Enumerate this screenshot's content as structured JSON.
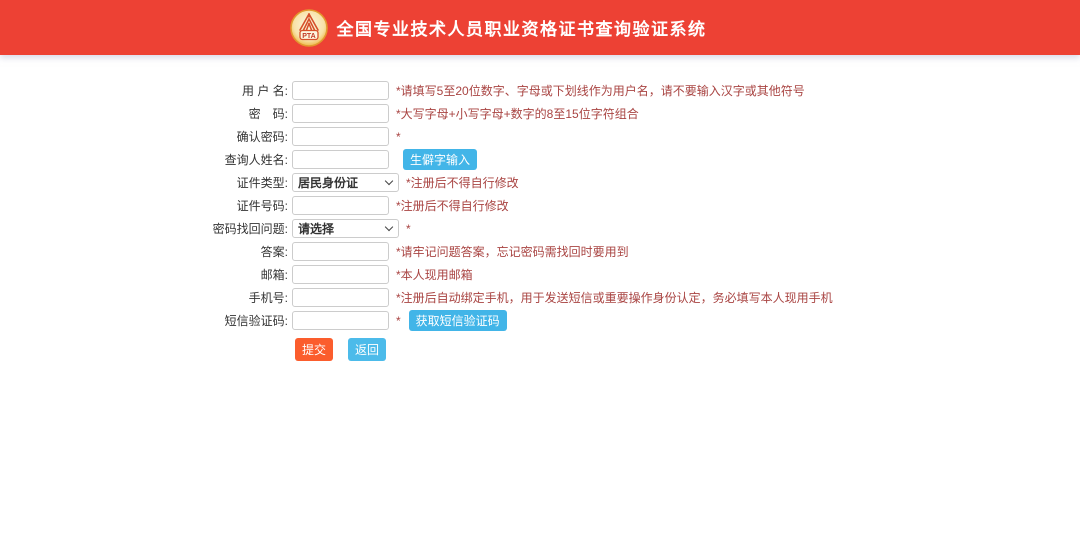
{
  "colors": {
    "header_bg": "#ed4134",
    "primary_blue": "#42b5e8",
    "submit_orange": "#fb5d2d",
    "hint_red": "#a94442"
  },
  "header": {
    "title": "全国专业技术人员职业资格证书查询验证系统",
    "logo_text": "PTA"
  },
  "form": {
    "rows": [
      {
        "label": "用 户 名:",
        "value": "",
        "placeholder": "",
        "hint": "*请填写5至20位数字、字母或下划线作为用户名，请不要输入汉字或其他符号"
      },
      {
        "label": "密　码:",
        "value": "",
        "placeholder": "",
        "hint": "*大写字母+小写字母+数字的8至15位字符组合"
      },
      {
        "label": "确认密码:",
        "value": "",
        "placeholder": "",
        "hint": "*"
      },
      {
        "label": "查询人姓名:",
        "value": "",
        "placeholder": "",
        "button": "生僻字输入"
      },
      {
        "label": "证件类型:",
        "selected": "居民身份证",
        "hint": "*注册后不得自行修改"
      },
      {
        "label": "证件号码:",
        "value": "",
        "placeholder": "",
        "hint": "*注册后不得自行修改"
      },
      {
        "label": "密码找回问题:",
        "selected": "请选择",
        "hint": "*"
      },
      {
        "label": "答案:",
        "value": "",
        "placeholder": "",
        "hint": "*请牢记问题答案，忘记密码需找回时要用到"
      },
      {
        "label": "邮箱:",
        "value": "",
        "placeholder": "",
        "hint": "*本人现用邮箱"
      },
      {
        "label": "手机号:",
        "value": "",
        "placeholder": "",
        "hint": "*注册后自动绑定手机，用于发送短信或重要操作身份认定，务必填写本人现用手机"
      },
      {
        "label": "短信验证码:",
        "value": "",
        "placeholder": "",
        "hint": "*",
        "button": "获取短信验证码"
      }
    ],
    "submit_label": "提交",
    "back_label": "返回"
  }
}
